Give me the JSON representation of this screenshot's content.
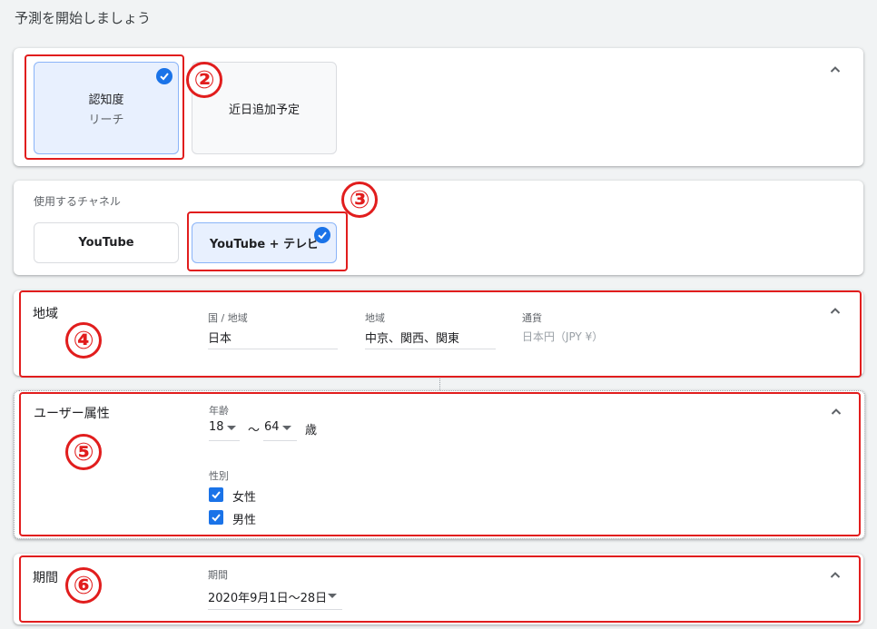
{
  "page": {
    "title": "予測を開始しましょう"
  },
  "goal": {
    "awareness": {
      "title": "認知度",
      "subtitle": "リーチ"
    },
    "coming_soon": {
      "title": "近日追加予定"
    }
  },
  "channels": {
    "label": "使用するチャネル",
    "youtube": "YouTube",
    "youtube_tv": "YouTube + テレビ"
  },
  "region": {
    "section_title": "地域",
    "country_label": "国 / 地域",
    "country_value": "日本",
    "area_label": "地域",
    "area_value": "中京、関西、関東",
    "currency_label": "通貨",
    "currency_value": "日本円（JPY ¥）"
  },
  "demographics": {
    "section_title": "ユーザー属性",
    "age_label": "年齢",
    "age_min": "18",
    "age_sep": "～",
    "age_max": "64",
    "age_unit": "歳",
    "gender_label": "性別",
    "female": "女性",
    "male": "男性"
  },
  "period": {
    "section_title": "期間",
    "field_label": "期間",
    "value": "2020年9月1日～28日"
  },
  "annotations": [
    "②",
    "③",
    "④",
    "⑤",
    "⑥"
  ],
  "colors": {
    "accent": "#1a73e8",
    "annotation": "#e11d1d",
    "selected_bg": "#e8f0fe"
  }
}
